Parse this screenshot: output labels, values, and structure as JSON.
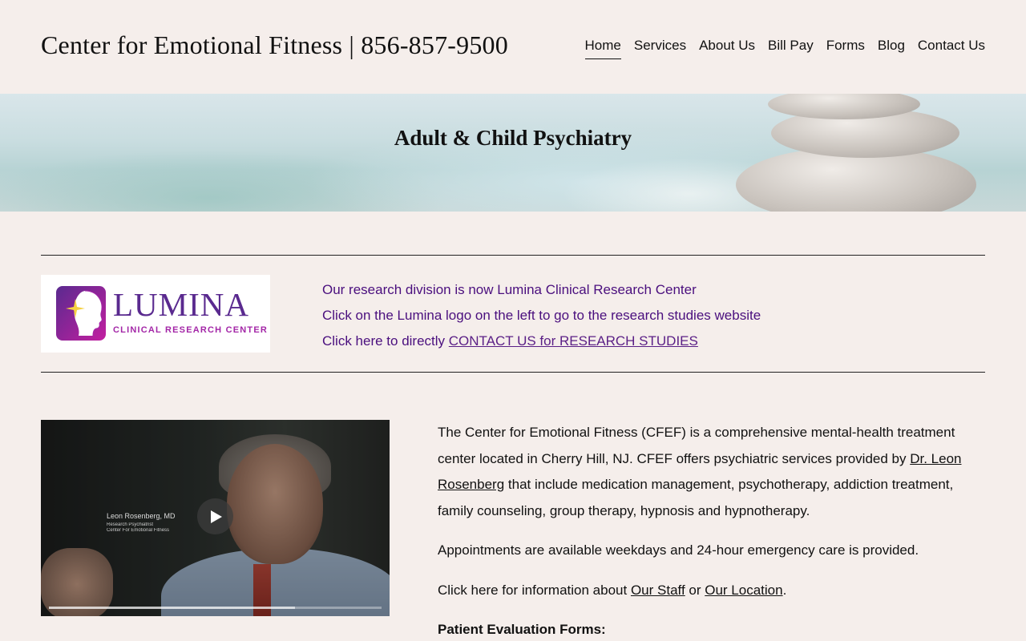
{
  "header": {
    "site_title": "Center for Emotional Fitness | 856-857-9500",
    "nav": [
      {
        "label": "Home",
        "active": true
      },
      {
        "label": "Services"
      },
      {
        "label": "About Us"
      },
      {
        "label": "Bill Pay"
      },
      {
        "label": "Forms"
      },
      {
        "label": "Blog"
      },
      {
        "label": "Contact Us"
      }
    ]
  },
  "hero": {
    "title": "Adult & Child Psychiatry"
  },
  "lumina": {
    "logo_word": "LUMINA",
    "logo_sub": "CLINICAL RESEARCH CENTER",
    "line1": "Our research division is now Lumina Clinical Research Center",
    "line2": "Click on the Lumina logo on the left to go to the research studies website",
    "line3_prefix": "Click here to directly ",
    "line3_link": "CONTACT US for RESEARCH STUDIES",
    "colors": {
      "purple": "#5a2a8f",
      "magenta": "#a326a7",
      "text": "#4a0f7e"
    }
  },
  "video": {
    "caption_name": "Leon Rosenberg, MD",
    "caption_title1": "Research Psychiatrist",
    "caption_title2": "Center For Emotional Fitness",
    "icon": "play-icon",
    "progress": 0.74
  },
  "about": {
    "p1_a": "The Center for Emotional Fitness (CFEF) is a comprehensive mental-health treatment center located in Cherry Hill, NJ.  CFEF offers psychiatric services provided by ",
    "p1_link": "Dr. Leon Rosenberg",
    "p1_b": " that include medication management, psychotherapy, addiction treatment, family counseling, group therapy, hypnosis and hypnotherapy.",
    "p2": "Appointments are available weekdays and 24-hour emergency care is provided.",
    "p3_a": "Click here for information about ",
    "p3_link1": "Our Staff",
    "p3_mid": " or ",
    "p3_link2": "Our Location",
    "p3_end": ".",
    "p4": "Patient Evaluation Forms:"
  }
}
